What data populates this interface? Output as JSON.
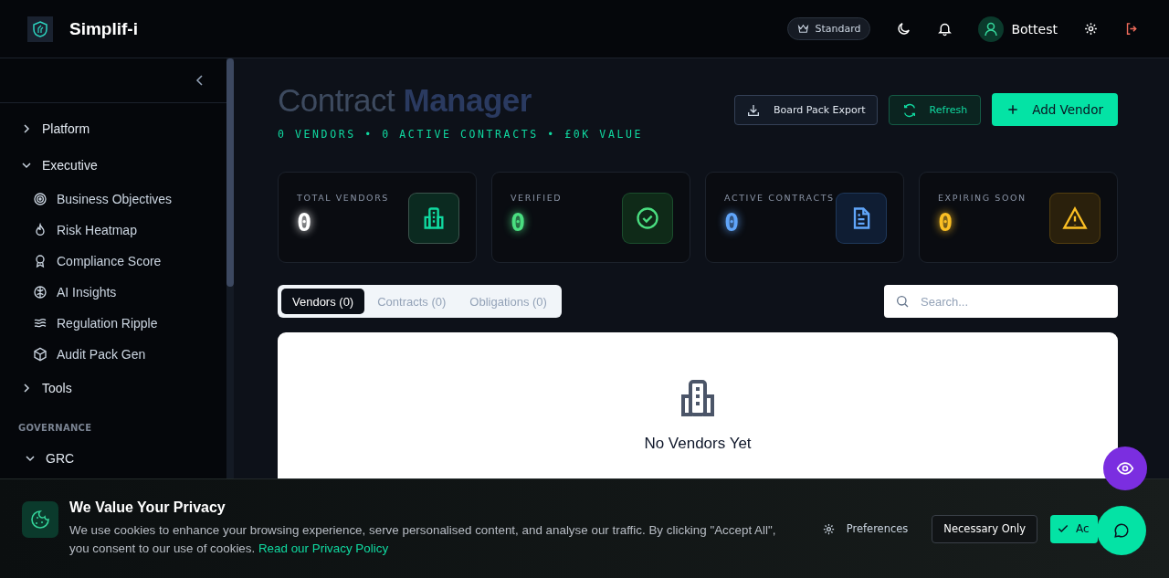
{
  "header": {
    "brand": "Simplif-i",
    "plan": "Standard",
    "user": "Bottest"
  },
  "sidebar": {
    "groups": [
      {
        "label": "Platform",
        "expanded": false
      },
      {
        "label": "Executive",
        "expanded": true,
        "children": [
          {
            "label": "Business Objectives",
            "kind": "target"
          },
          {
            "label": "Risk Heatmap",
            "kind": "flame"
          },
          {
            "label": "Compliance Score",
            "kind": "award"
          },
          {
            "label": "AI Insights",
            "kind": "brain"
          },
          {
            "label": "Regulation Ripple",
            "kind": "waves"
          },
          {
            "label": "Audit Pack Gen",
            "kind": "package"
          }
        ]
      },
      {
        "label": "Tools",
        "expanded": false
      }
    ],
    "section": "GOVERNANCE",
    "section_groups": [
      {
        "label": "GRC",
        "expanded": true
      }
    ]
  },
  "page": {
    "title": "Contract",
    "title_highlight": "Manager",
    "subtitle": "0 VENDORS • 0 ACTIVE CONTRACTS • £0K VALUE",
    "actions": [
      {
        "label": "Board Pack Export",
        "kind": "export"
      },
      {
        "label": "Refresh",
        "kind": "refresh"
      },
      {
        "label": "Add Vendor",
        "kind": "add"
      }
    ]
  },
  "stats": [
    {
      "label": "TOTAL VENDORS",
      "value": "0",
      "color": "#ffffff",
      "kind": "building"
    },
    {
      "label": "VERIFIED",
      "value": "0",
      "color": "#4ade80",
      "kind": "check"
    },
    {
      "label": "ACTIVE CONTRACTS",
      "value": "0",
      "color": "#60a5fa",
      "kind": "document"
    },
    {
      "label": "EXPIRING SOON",
      "value": "0",
      "color": "#fbbf24",
      "kind": "warning"
    }
  ],
  "tabs": [
    {
      "label": "Vendors (0)",
      "selected": true
    },
    {
      "label": "Contracts (0)",
      "selected": false
    },
    {
      "label": "Obligations (0)",
      "selected": false
    }
  ],
  "search": {
    "placeholder": "Search..."
  },
  "empty": {
    "title": "No Vendors Yet"
  },
  "cookie": {
    "title": "We Value Your Privacy",
    "text": "We use cookies to enhance your browsing experience, serve personalised content, and analyse our traffic. By clicking \"Accept All\", you consent to our use of cookies.",
    "link": "Read our Privacy Policy",
    "preferences": "Preferences",
    "necessary": "Necessary Only",
    "accept": "Ac"
  }
}
